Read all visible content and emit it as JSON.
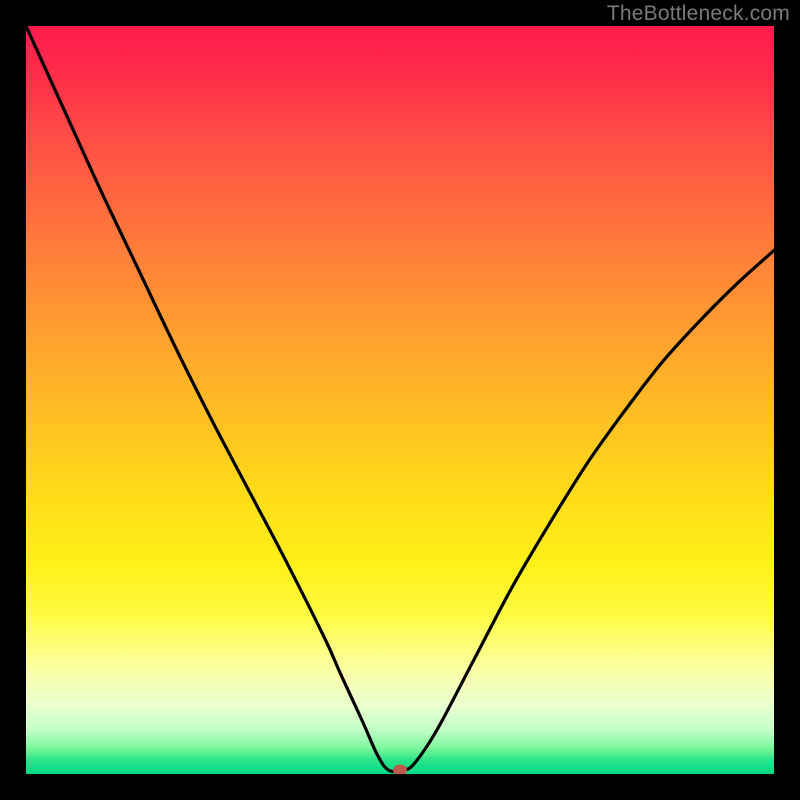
{
  "watermark": {
    "text": "TheBottleneck.com"
  },
  "chart_data": {
    "type": "line",
    "title": "",
    "xlabel": "",
    "ylabel": "",
    "xlim": [
      0,
      100
    ],
    "ylim": [
      0,
      100
    ],
    "grid": false,
    "background_gradient": {
      "direction": "vertical",
      "stops": [
        {
          "pos": 0,
          "color": "#ff1a4d"
        },
        {
          "pos": 0.24,
          "color": "#ff6a3f"
        },
        {
          "pos": 0.54,
          "color": "#ffc421"
        },
        {
          "pos": 0.79,
          "color": "#fffb45"
        },
        {
          "pos": 0.94,
          "color": "#c4ffc8"
        },
        {
          "pos": 1.0,
          "color": "#00da86"
        }
      ]
    },
    "series": [
      {
        "name": "bottleneck-curve",
        "color": "#000000",
        "x": [
          0,
          5,
          10,
          15,
          20,
          25,
          30,
          35,
          40,
          42,
          45,
          47,
          48.5,
          50.5,
          52,
          55,
          60,
          65,
          70,
          75,
          80,
          85,
          90,
          95,
          100
        ],
        "y": [
          100,
          89,
          78,
          67.5,
          57,
          47,
          37.5,
          28,
          18,
          13.5,
          7,
          2.5,
          0.5,
          0.5,
          1.5,
          6,
          15.5,
          25,
          33.5,
          41.5,
          48.5,
          55,
          60.5,
          65.5,
          70
        ]
      }
    ],
    "marker": {
      "name": "bottleneck-point",
      "x": 50,
      "y": 0.5,
      "color": "#c0594d"
    }
  }
}
